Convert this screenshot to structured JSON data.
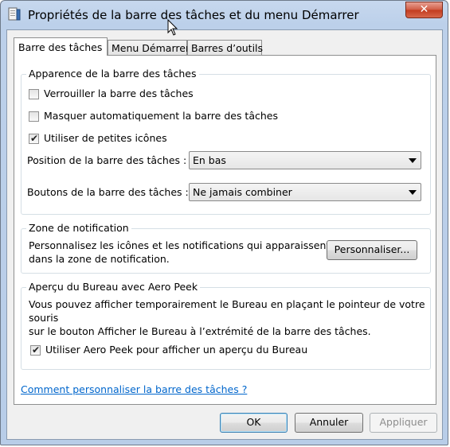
{
  "window": {
    "title": "Propriétés de la barre des tâches et du menu Démarrer",
    "close_label": "✕"
  },
  "tabs": [
    {
      "label": "Barre des tâches",
      "active": true
    },
    {
      "label": "Menu Démarrer",
      "active": false
    },
    {
      "label": "Barres d’outils",
      "active": false
    }
  ],
  "appearance": {
    "legend": "Apparence de la barre des tâches",
    "lock": {
      "label": "Verrouiller la barre des tâches",
      "checked": false
    },
    "autohide": {
      "label": "Masquer automatiquement la barre des tâches",
      "checked": false
    },
    "small_icons": {
      "label": "Utiliser de petites icônes",
      "checked": true
    },
    "position": {
      "label": "Position de la barre des tâches :",
      "value": "En bas"
    },
    "buttons": {
      "label": "Boutons de la barre des tâches :",
      "value": "Ne jamais combiner"
    }
  },
  "notification": {
    "legend": "Zone de notification",
    "text_line1": "Personnalisez les icônes et les notifications qui apparaissent",
    "text_line2": "dans la zone de notification.",
    "customize_label": "Personnaliser..."
  },
  "aero_peek": {
    "legend": "Aperçu du Bureau avec Aero Peek",
    "text_line1": "Vous pouvez afficher temporairement le Bureau en plaçant le pointeur de votre souris",
    "text_line2": "sur le bouton Afficher le Bureau à l’extrémité de la barre des tâches.",
    "use_peek": {
      "label": "Utiliser Aero Peek pour afficher un aperçu du Bureau",
      "checked": true
    }
  },
  "help_link": "Comment personnaliser la barre des tâches ?",
  "buttons": {
    "ok": "OK",
    "cancel": "Annuler",
    "apply": "Appliquer"
  },
  "colors": {
    "link": "#0066cc",
    "close_button": "#c23b1f",
    "titlebar": "#bcd0ea"
  }
}
